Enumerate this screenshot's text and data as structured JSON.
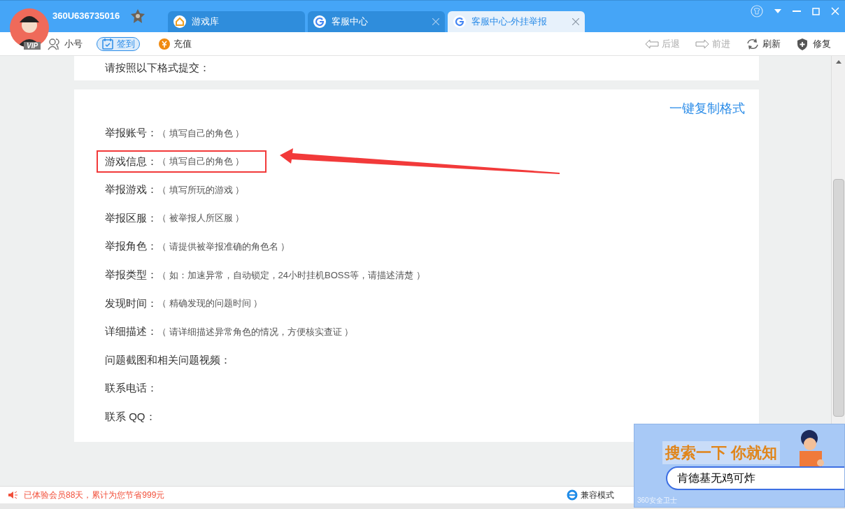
{
  "account": {
    "user": "360U636735016",
    "vip_badge": "VIP"
  },
  "tabs": [
    {
      "label": "游戏库",
      "selected": false
    },
    {
      "label": "客服中心",
      "selected": false
    },
    {
      "label": "客服中心-外挂举报",
      "selected": true
    }
  ],
  "toolbar": {
    "left": [
      {
        "kind": "people",
        "label": "小号"
      },
      {
        "kind": "checkin",
        "label": "签到"
      },
      {
        "kind": "coin",
        "label": "充值"
      }
    ],
    "right": [
      {
        "kind": "back",
        "label": "后退",
        "disabled": true
      },
      {
        "kind": "forward",
        "label": "前进",
        "disabled": true
      },
      {
        "kind": "refresh",
        "label": "刷新",
        "disabled": false
      },
      {
        "kind": "repair",
        "label": "修复",
        "disabled": false
      }
    ]
  },
  "content": {
    "heading": "请按照以下格式提交：",
    "copy_link": "一键复制格式",
    "fields": [
      {
        "label": "举报账号：",
        "hint": "（ 填写自己的角色 ）",
        "highlighted": false
      },
      {
        "label": "游戏信息：",
        "hint": "（ 填写自己的角色 ）",
        "highlighted": true
      },
      {
        "label": "举报游戏：",
        "hint": "（ 填写所玩的游戏 ）",
        "highlighted": false
      },
      {
        "label": "举报区服：",
        "hint": "（ 被举报人所区服 ）",
        "highlighted": false
      },
      {
        "label": "举报角色：",
        "hint": "（ 请提供被举报准确的角色名 ）",
        "highlighted": false
      },
      {
        "label": "举报类型：",
        "hint": "（ 如：加速异常，自动锁定，24小时挂机BOSS等，请描述清楚 ）",
        "highlighted": false
      },
      {
        "label": "发现时间：",
        "hint": "（ 精确发现的问题时间 ）",
        "highlighted": false
      },
      {
        "label": "详细描述：",
        "hint": "（ 请详细描述异常角色的情况，方便核实查证 ）",
        "highlighted": false
      },
      {
        "label": "问题截图和相关问题视频：",
        "highlighted": false
      },
      {
        "label": "联系电话：",
        "highlighted": false
      },
      {
        "label": "联系 QQ：",
        "highlighted": false
      }
    ]
  },
  "status_bar": {
    "message": "已体验会员88天，累计为您节省999元",
    "mode": "兼容模式"
  },
  "popup": {
    "slogan": "搜索一下 你就知",
    "search_text": "肯德基无鸡可炸",
    "brand": "360安全卫士"
  }
}
